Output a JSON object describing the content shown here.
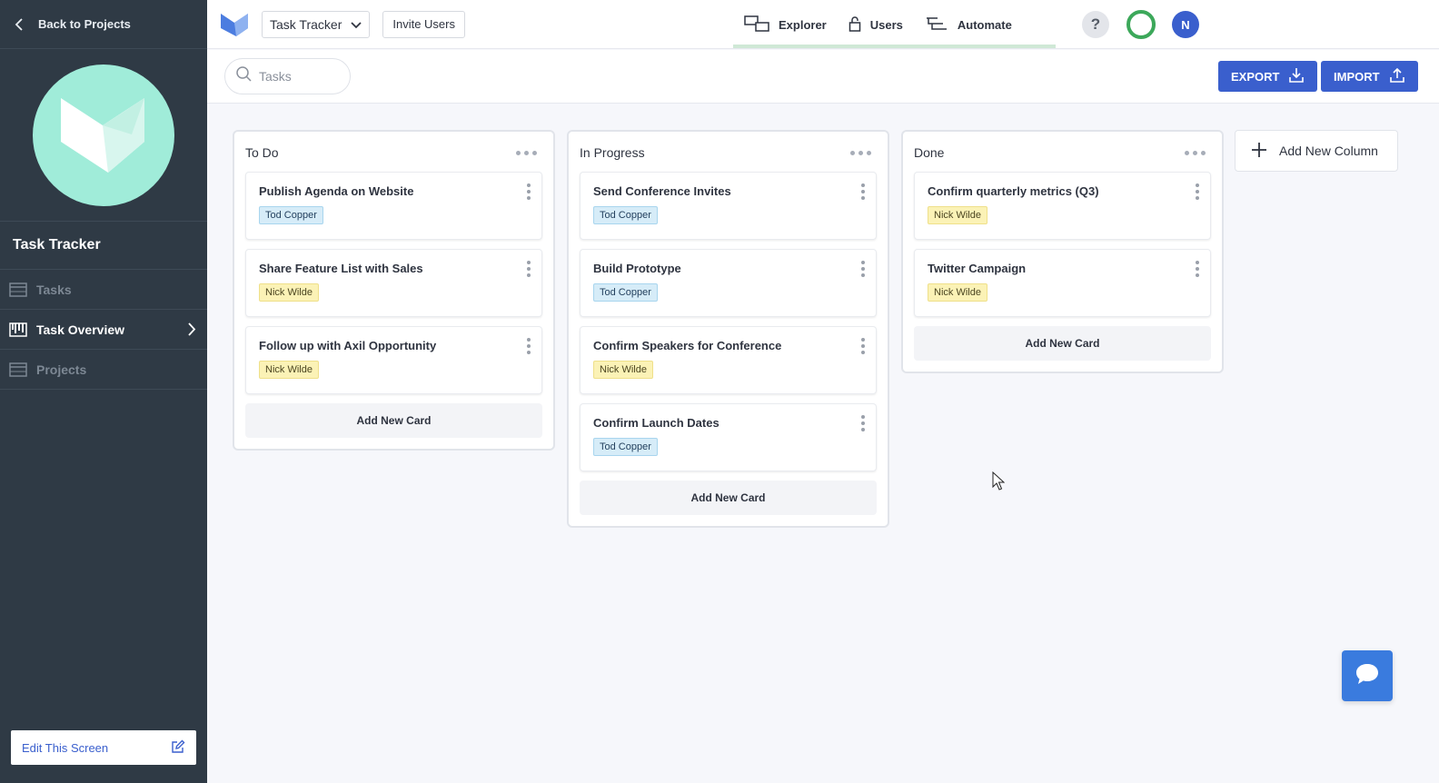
{
  "sidebar": {
    "back_label": "Back to Projects",
    "app_name": "Task Tracker",
    "items": [
      {
        "label": "Tasks",
        "icon": "table-icon"
      },
      {
        "label": "Task Overview",
        "icon": "kanban-icon"
      },
      {
        "label": "Projects",
        "icon": "table-icon"
      }
    ],
    "edit_label": "Edit This Screen"
  },
  "topbar": {
    "app_select": "Task Tracker",
    "invite_label": "Invite Users",
    "nav": [
      {
        "label": "Explorer",
        "icon": "explorer-icon"
      },
      {
        "label": "Users",
        "icon": "lock-icon"
      },
      {
        "label": "Automate",
        "icon": "automate-icon"
      }
    ],
    "help": "?",
    "avatar_initial": "N"
  },
  "toolbar": {
    "search_placeholder": "Tasks",
    "export_label": "EXPORT",
    "import_label": "IMPORT"
  },
  "board": {
    "columns": [
      {
        "title": "To Do",
        "cards": [
          {
            "title": "Publish Agenda on Website",
            "assignee": "Tod Copper",
            "color": "blue"
          },
          {
            "title": "Share Feature List with Sales",
            "assignee": "Nick Wilde",
            "color": "yellow"
          },
          {
            "title": "Follow up with Axil Opportunity",
            "assignee": "Nick Wilde",
            "color": "yellow"
          }
        ],
        "add_card_label": "Add New Card"
      },
      {
        "title": "In Progress",
        "cards": [
          {
            "title": "Send Conference Invites",
            "assignee": "Tod Copper",
            "color": "blue"
          },
          {
            "title": "Build Prototype",
            "assignee": "Tod Copper",
            "color": "blue"
          },
          {
            "title": "Confirm Speakers for Conference",
            "assignee": "Nick Wilde",
            "color": "yellow"
          },
          {
            "title": "Confirm Launch Dates",
            "assignee": "Tod Copper",
            "color": "blue"
          }
        ],
        "add_card_label": "Add New Card"
      },
      {
        "title": "Done",
        "cards": [
          {
            "title": "Confirm quarterly metrics (Q3)",
            "assignee": "Nick Wilde",
            "color": "yellow"
          },
          {
            "title": "Twitter Campaign",
            "assignee": "Nick Wilde",
            "color": "yellow"
          }
        ],
        "add_card_label": "Add New Card"
      }
    ],
    "add_column_label": "Add New Column"
  },
  "colors": {
    "sidebar_bg": "#2f3a45",
    "accent": "#3a5fcd",
    "logo": "#a0ecd9",
    "tag_blue": "#d6ecf8",
    "tag_yellow": "#fbf2b6",
    "status_green": "#3ca85a"
  }
}
